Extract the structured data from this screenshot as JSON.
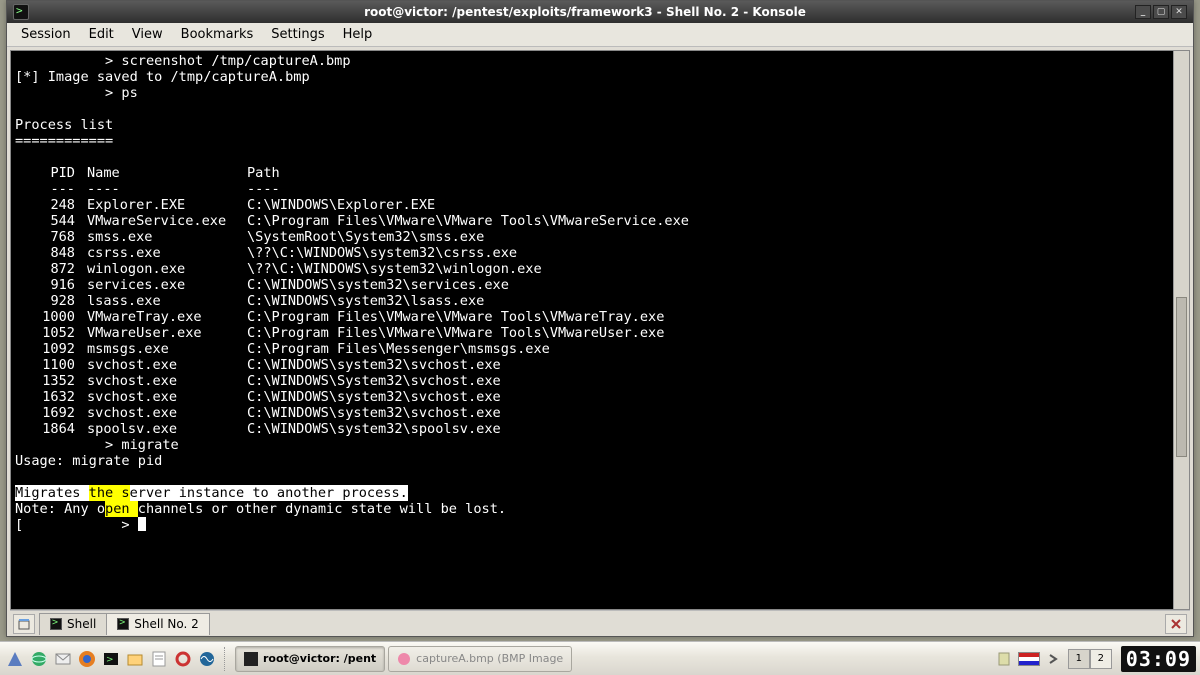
{
  "window": {
    "title": "root@victor: /pentest/exploits/framework3 - Shell No. 2 - Konsole"
  },
  "menu": {
    "items": [
      "Session",
      "Edit",
      "View",
      "Bookmarks",
      "Settings",
      "Help"
    ]
  },
  "terminal": {
    "prompt_redacted": "          ",
    "cmd1": " > screenshot /tmp/captureA.bmp",
    "saved": "[*] Image saved to /tmp/captureA.bmp",
    "cmd2": " > ps",
    "list_title": "Process list",
    "list_rule": "============",
    "header": {
      "pid": "PID",
      "name": "Name",
      "path": "Path"
    },
    "header_rule": {
      "pid": "---",
      "name": "----",
      "path": "----"
    },
    "processes": [
      {
        "pid": "248",
        "name": "Explorer.EXE",
        "path": "C:\\WINDOWS\\Explorer.EXE"
      },
      {
        "pid": "544",
        "name": "VMwareService.exe",
        "path": "C:\\Program Files\\VMware\\VMware Tools\\VMwareService.exe"
      },
      {
        "pid": "768",
        "name": "smss.exe",
        "path": "\\SystemRoot\\System32\\smss.exe"
      },
      {
        "pid": "848",
        "name": "csrss.exe",
        "path": "\\??\\C:\\WINDOWS\\system32\\csrss.exe"
      },
      {
        "pid": "872",
        "name": "winlogon.exe",
        "path": "\\??\\C:\\WINDOWS\\system32\\winlogon.exe"
      },
      {
        "pid": "916",
        "name": "services.exe",
        "path": "C:\\WINDOWS\\system32\\services.exe"
      },
      {
        "pid": "928",
        "name": "lsass.exe",
        "path": "C:\\WINDOWS\\system32\\lsass.exe"
      },
      {
        "pid": "1000",
        "name": "VMwareTray.exe",
        "path": "C:\\Program Files\\VMware\\VMware Tools\\VMwareTray.exe"
      },
      {
        "pid": "1052",
        "name": "VMwareUser.exe",
        "path": "C:\\Program Files\\VMware\\VMware Tools\\VMwareUser.exe"
      },
      {
        "pid": "1092",
        "name": "msmsgs.exe",
        "path": "C:\\Program Files\\Messenger\\msmsgs.exe"
      },
      {
        "pid": "1100",
        "name": "svchost.exe",
        "path": "C:\\WINDOWS\\system32\\svchost.exe"
      },
      {
        "pid": "1352",
        "name": "svchost.exe",
        "path": "C:\\WINDOWS\\System32\\svchost.exe"
      },
      {
        "pid": "1632",
        "name": "svchost.exe",
        "path": "C:\\WINDOWS\\system32\\svchost.exe"
      },
      {
        "pid": "1692",
        "name": "svchost.exe",
        "path": "C:\\WINDOWS\\system32\\svchost.exe"
      },
      {
        "pid": "1864",
        "name": "spoolsv.exe",
        "path": "C:\\WINDOWS\\system32\\spoolsv.exe"
      }
    ],
    "cmd3": " > migrate",
    "usage": "Usage: migrate pid",
    "help_pre": "Migrates ",
    "help_hl1": "the s",
    "help_post1": "erver instance to another process.",
    "note_pre": "Note: Any o",
    "note_hl": "pen ",
    "note_post": "channels or other dynamic state will be lost.",
    "final_prompt": " > ",
    "final_prefix": "[ "
  },
  "tabs": {
    "new_icon": "new-tab-icon",
    "items": [
      "Shell",
      "Shell No. 2"
    ],
    "active_index": 1
  },
  "taskbar": {
    "task_active": "root@victor: /pent",
    "task_other": "captureA.bmp (BMP Image",
    "pager": [
      "1",
      "2"
    ],
    "pager_active": 0,
    "clock": "03:09",
    "locale": "us"
  }
}
